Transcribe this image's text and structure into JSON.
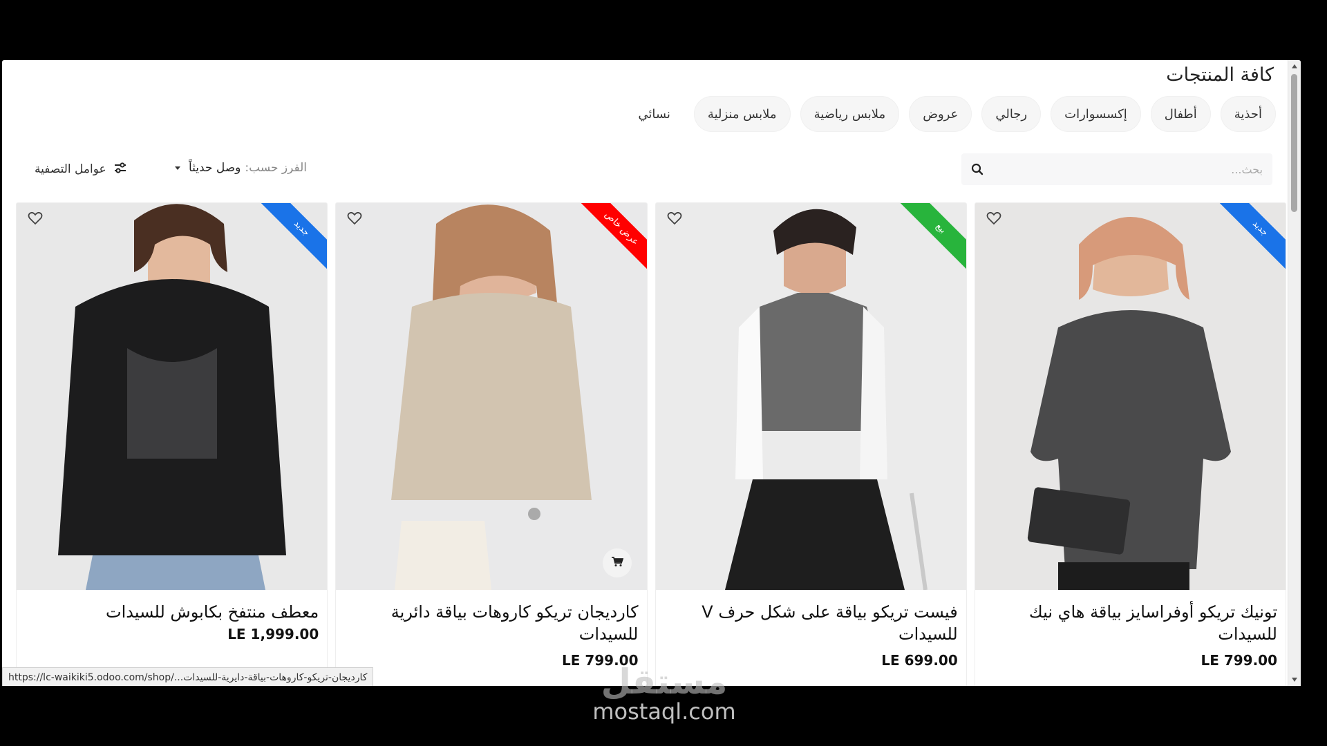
{
  "page": {
    "title": "كافة المنتجات"
  },
  "categories": [
    {
      "label": "أحذية"
    },
    {
      "label": "أطفال"
    },
    {
      "label": "إكسسوارات"
    },
    {
      "label": "رجالي"
    },
    {
      "label": "عروض"
    },
    {
      "label": "ملابس رياضية"
    },
    {
      "label": "ملابس منزلية"
    },
    {
      "label": "نسائي"
    }
  ],
  "search": {
    "placeholder": "بحث...",
    "icon": "search-icon"
  },
  "sort": {
    "label": "الفرز حسب:",
    "value": "وصل حديثاً"
  },
  "filters": {
    "label": "عوامل التصفية",
    "icon": "sliders-icon"
  },
  "products": [
    {
      "name": "معطف منتفخ بكابوش للسيدات",
      "price": "LE 1,999.00",
      "ribbon": "جديد",
      "ribbon_color": "#1a73e8",
      "image_bg": "#e8e8e8"
    },
    {
      "name": "كارديجان تريكو كاروهات بياقة دائرية للسيدات",
      "price": "LE 799.00",
      "ribbon": "عرض خاص",
      "ribbon_color": "#ff0000",
      "image_bg": "#ebebeb"
    },
    {
      "name": "فيست تريكو بياقة على شكل حرف V للسيدات",
      "price": "LE 699.00",
      "ribbon": "بيع",
      "ribbon_color": "#28b43c",
      "image_bg": "#eceae8"
    },
    {
      "name": "تونيك تريكو أوفراسايز بياقة هاي نيك للسيدات",
      "price": "LE 799.00",
      "ribbon": "جديد",
      "ribbon_color": "#1a73e8",
      "image_bg": "#e6e6e6"
    }
  ],
  "status_bar": {
    "url": "https://lc-waikiki5.odoo.com/shop/...كارديجان-تريكو-كاروهات-بياقة-دايرية-للسيدات"
  },
  "watermark": {
    "arabic": "مستقل",
    "english": "mostaql.com"
  }
}
